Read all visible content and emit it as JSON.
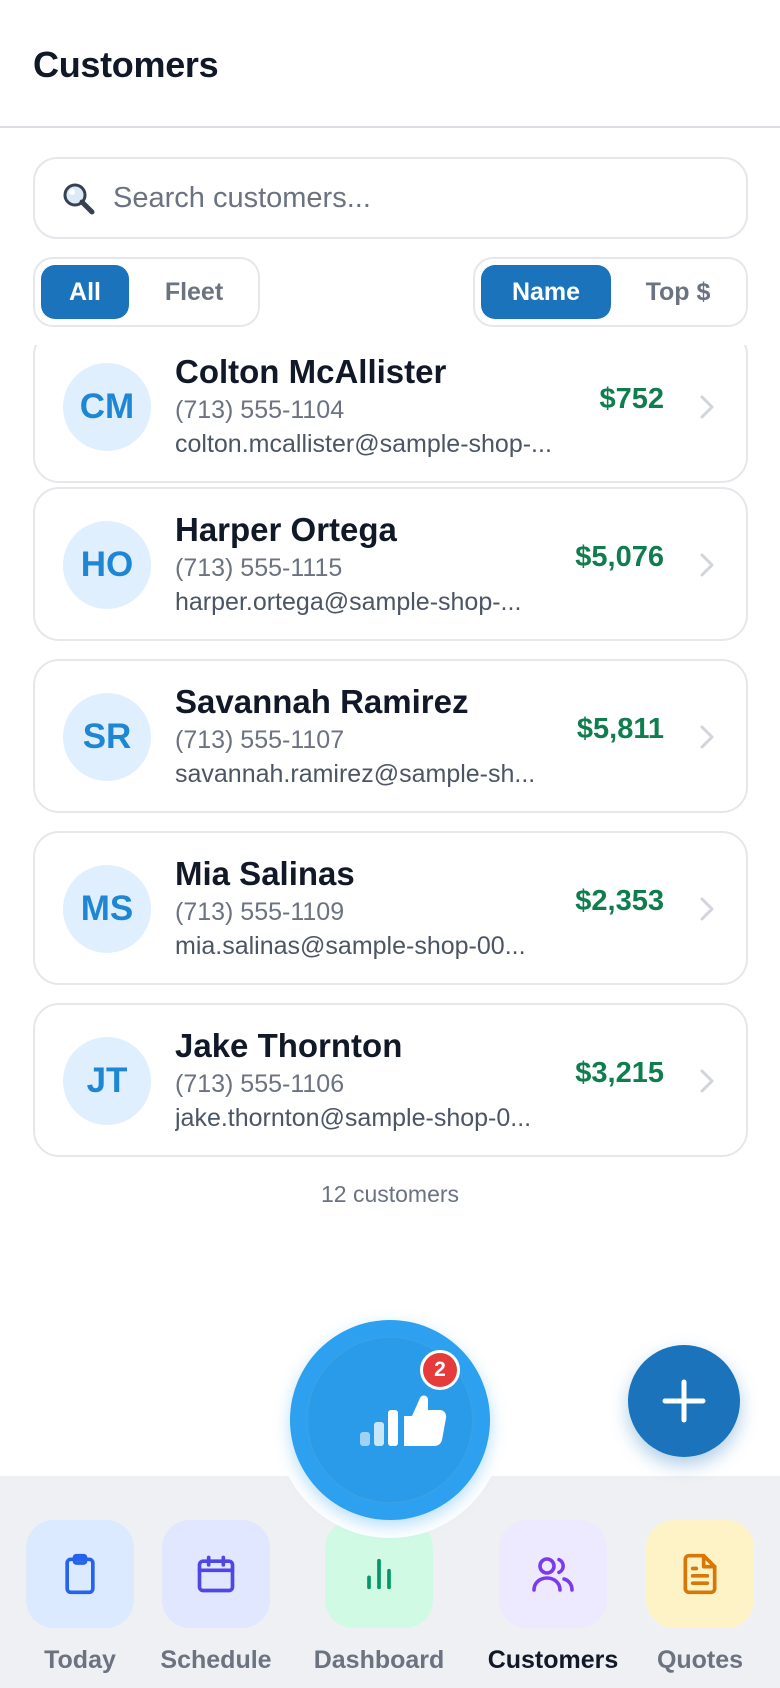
{
  "header": {
    "title": "Customers"
  },
  "search": {
    "placeholder": "Search customers..."
  },
  "filters": {
    "type": {
      "options": [
        "All",
        "Fleet"
      ],
      "selected": "All"
    },
    "sort": {
      "options": [
        "Name",
        "Top $"
      ],
      "selected": "Name"
    }
  },
  "customers": [
    {
      "initials": "CM",
      "name": "Colton McAllister",
      "phone": "(713) 555-1104",
      "email": "colton.mcallister@sample-shop-...",
      "total": "$752"
    },
    {
      "initials": "HO",
      "name": "Harper Ortega",
      "phone": "(713) 555-1115",
      "email": "harper.ortega@sample-shop-...",
      "total": "$5,076"
    },
    {
      "initials": "SR",
      "name": "Savannah Ramirez",
      "phone": "(713) 555-1107",
      "email": "savannah.ramirez@sample-sh...",
      "total": "$5,811"
    },
    {
      "initials": "MS",
      "name": "Mia Salinas",
      "phone": "(713) 555-1109",
      "email": "mia.salinas@sample-shop-00...",
      "total": "$2,353"
    },
    {
      "initials": "JT",
      "name": "Jake Thornton",
      "phone": "(713) 555-1106",
      "email": "jake.thornton@sample-shop-0...",
      "total": "$3,215"
    }
  ],
  "footer": {
    "count_text": "12 customers"
  },
  "fab": {
    "badge": "2",
    "icon": "feedback-thumbs-up-icon",
    "add_icon": "plus-icon"
  },
  "tabs": [
    {
      "label": "Today",
      "icon": "clipboard-icon",
      "bg": "#dbeafe",
      "color": "#2563eb"
    },
    {
      "label": "Schedule",
      "icon": "calendar-icon",
      "bg": "#e0e7ff",
      "color": "#4f46e5"
    },
    {
      "label": "Dashboard",
      "icon": "bar-chart-icon",
      "bg": "#d1fae5",
      "color": "#059669"
    },
    {
      "label": "Customers",
      "icon": "users-icon",
      "bg": "#ede9fe",
      "color": "#7c3aed",
      "active": true
    },
    {
      "label": "Quotes",
      "icon": "document-icon",
      "bg": "#fef3c7",
      "color": "#d97706"
    }
  ],
  "colors": {
    "primary": "#1a73bb",
    "accent": "#2ea0f0",
    "money": "#0f7d4d",
    "badge": "#e63b3b"
  }
}
